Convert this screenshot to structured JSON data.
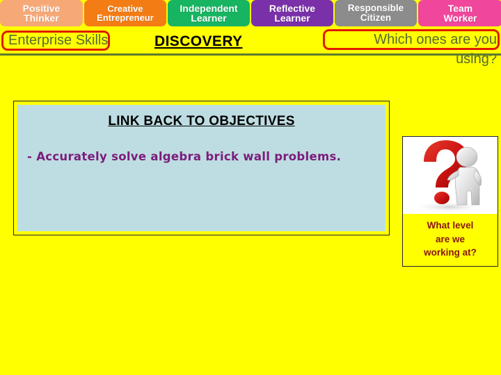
{
  "slide": {
    "background_color": "#FFFF00"
  },
  "tab_strip": {
    "tabs": [
      {
        "line1": "Positive",
        "line2": "Thinker",
        "color": "#F7A877",
        "text_color": "#FFFFFF"
      },
      {
        "line1": "Creative",
        "line2": "Entrepreneur",
        "color": "#F47C15",
        "text_color": "#FFFFFF"
      },
      {
        "line1": "Independent",
        "line2": "Learner",
        "color": "#17B461",
        "text_color": "#FFFFFF"
      },
      {
        "line1": "Reflective",
        "line2": "Learner",
        "color": "#7A30A8",
        "text_color": "#FFFFFF"
      },
      {
        "line1": "Responsible",
        "line2": "Citizen",
        "color": "#8C8C8C",
        "text_color": "#FFFFFF"
      },
      {
        "line1": "Team",
        "line2": "Worker",
        "color": "#F0469B",
        "text_color": "#FFFFFF"
      }
    ]
  },
  "banner": {
    "enterprise_skills": "Enterprise Skills",
    "discovery": "DISCOVERY",
    "which_ones_line1": "Which ones are you",
    "which_ones_line2": "using?",
    "highlight_color": "#E01B00",
    "text_color": "#556B2F",
    "divider_color": "#5F7A2E"
  },
  "objectives": {
    "title": "LINK BACK TO OBJECTIVES",
    "body": "- Accurately solve algebra brick wall problems.",
    "fill_color": "#BEDDE2",
    "border_color": "#FFFF00",
    "body_color": "#7B1D7B"
  },
  "question_panel": {
    "image_alt": "question-mark-thinking-figure",
    "caption_line1": "What level",
    "caption_line2": "are we",
    "caption_line3": "working at?",
    "caption_color": "#8A1414",
    "question_mark_color": "#CC1111",
    "figure_color": "#DCDCDC"
  }
}
